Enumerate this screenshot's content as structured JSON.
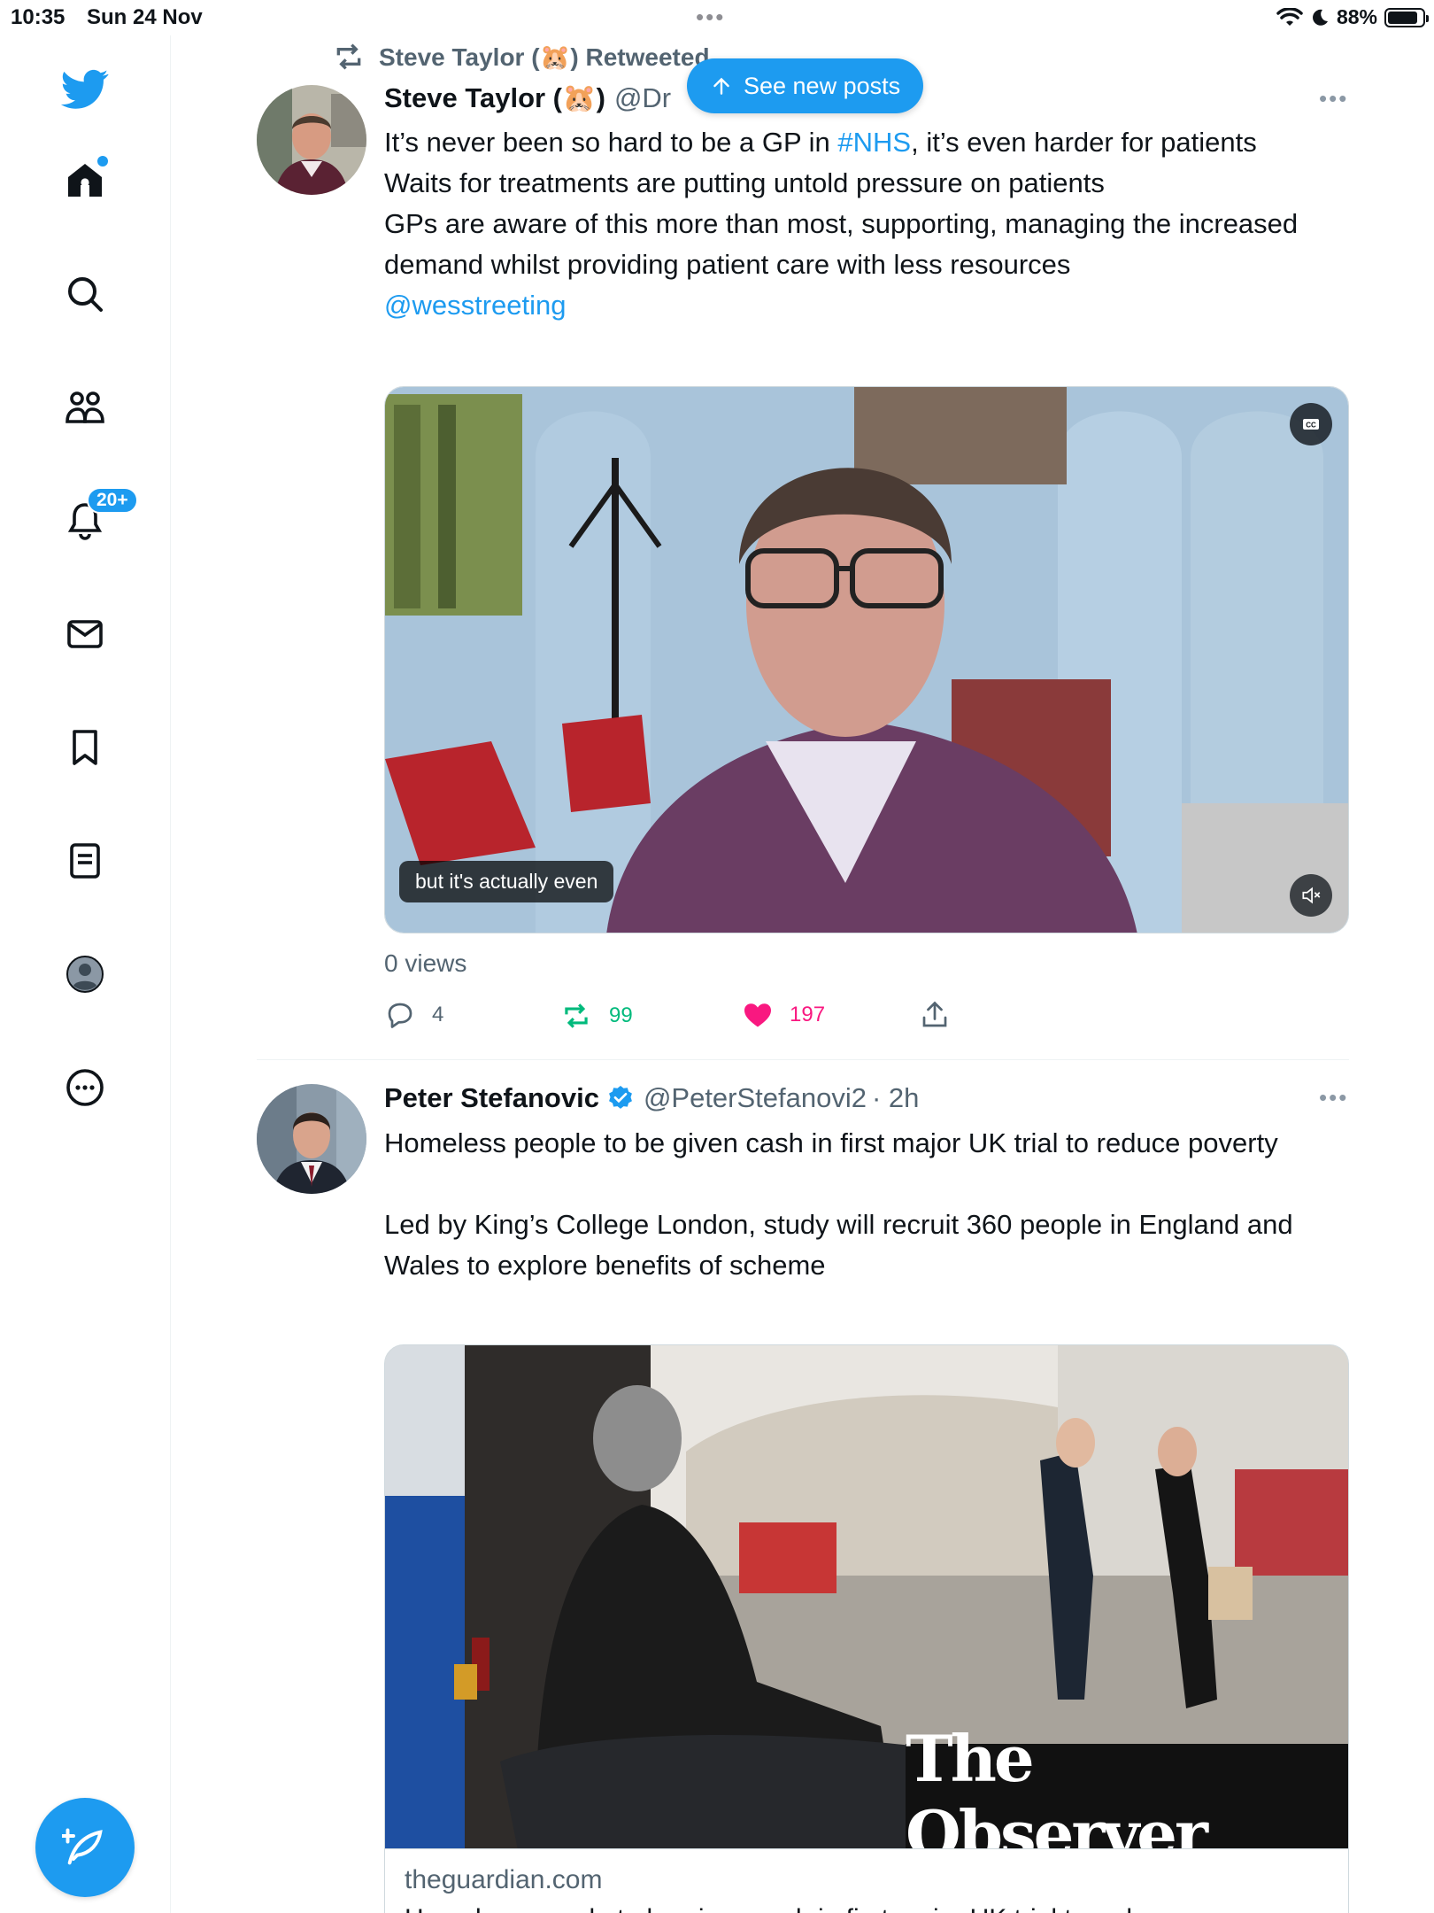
{
  "status_bar": {
    "time": "10:35",
    "date": "Sun 24 Nov",
    "battery": "88%",
    "battery_level": 0.88
  },
  "sidebar": {
    "notifications_badge": "20+",
    "items": [
      {
        "name": "twitter-logo"
      },
      {
        "name": "home"
      },
      {
        "name": "search"
      },
      {
        "name": "communities"
      },
      {
        "name": "notifications"
      },
      {
        "name": "messages"
      },
      {
        "name": "bookmarks"
      },
      {
        "name": "lists"
      },
      {
        "name": "profile"
      },
      {
        "name": "more"
      }
    ]
  },
  "timeline": {
    "see_new_posts": "See new posts",
    "tweets": [
      {
        "retweeted_by": "Steve Taylor (🐹) Retweeted",
        "name": "Steve Taylor (🐹)",
        "handle": "@Dr",
        "text_lines": [
          "It’s never been so hard to be a GP in ",
          "#NHS",
          ", it’s even harder for patients",
          "Waits for treatments are putting untold pressure on patients",
          "GPs are aware of this more than most, supporting, managing the increased demand whilst providing patient care with less resources",
          "@wesstreeting"
        ],
        "video_caption": "but it's actually even",
        "views": "0 views",
        "replies": "4",
        "retweets": "99",
        "likes": "197"
      },
      {
        "name": "Peter Stefanovic",
        "handle": "@PeterStefanovi2",
        "time": "· 2h",
        "paragraph_1": "Homeless people to be given cash in first major UK trial to reduce poverty",
        "paragraph_2": "Led by King’s College London, study will recruit 360 people in England and Wales to explore benefits of scheme",
        "image_watermark": "The Observer",
        "card_domain": "theguardian.com",
        "card_title": "Homeless people to be given cash in first major UK trial to reduce..."
      }
    ]
  },
  "colors": {
    "accent": "#1d9bf0",
    "retweet_green": "#00ba7c",
    "like_pink": "#f91880",
    "secondary_text": "#536471"
  }
}
